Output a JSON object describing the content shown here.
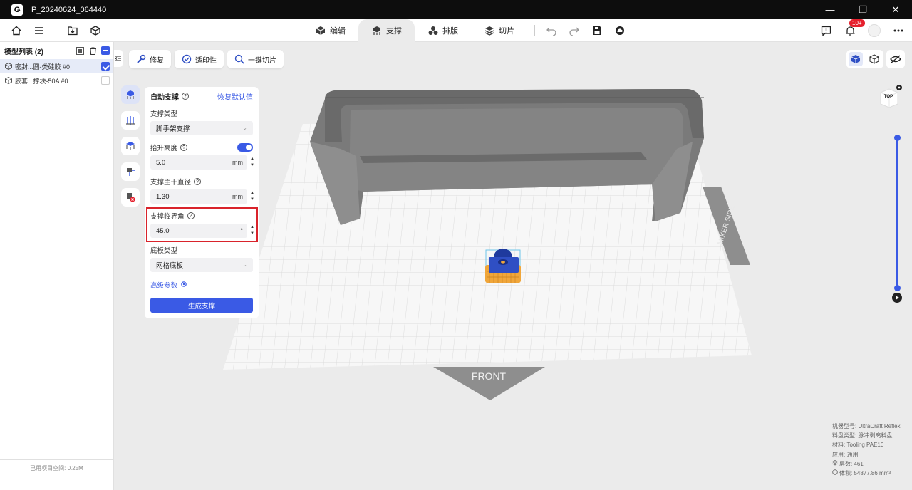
{
  "window": {
    "title": "P_20240624_064440",
    "logo_letter": "Ǥ",
    "controls": {
      "minimize": "—",
      "maximize": "❐",
      "close": "✕"
    }
  },
  "toolbar": {
    "tabs": [
      {
        "label": "编辑",
        "icon": "edit-cube-icon"
      },
      {
        "label": "支撑",
        "icon": "support-icon",
        "active": true
      },
      {
        "label": "排版",
        "icon": "layout-icon"
      },
      {
        "label": "切片",
        "icon": "slice-icon"
      }
    ],
    "notification_badge": "10+"
  },
  "sidebar": {
    "title": "模型列表 (2)",
    "models": [
      {
        "name": "密封...圆-类硅胶 #0",
        "selected": true
      },
      {
        "name": "胶套...撑块-50A #0",
        "selected": false
      }
    ],
    "storage": "已用项目空间: 0.25M"
  },
  "tools": {
    "repair": "修复",
    "printability": "适印性",
    "one_click_slice": "一键切片"
  },
  "support_panel": {
    "title": "自动支撑",
    "reset": "恢复默认值",
    "support_type_label": "支撑类型",
    "support_type_value": "脚手架支撑",
    "lift_height_label": "抬升高度",
    "lift_height_enabled": true,
    "lift_height_value": "5.0",
    "lift_height_unit": "mm",
    "trunk_diameter_label": "支撑主干直径",
    "trunk_diameter_value": "1.30",
    "trunk_diameter_unit": "mm",
    "critical_angle_label": "支撑临界角",
    "critical_angle_value": "45.0",
    "critical_angle_unit": "°",
    "base_type_label": "底板类型",
    "base_type_value": "网格底板",
    "advanced": "高级参数",
    "generate": "生成支撑"
  },
  "scene": {
    "front_label": "FRONT",
    "side_label": "MIXER SIDE",
    "cube_label": "TOP"
  },
  "info": {
    "machine": "机器型号: UltraCraft Reflex",
    "tray": "料盘类型: 脉冲剥离料盘",
    "material": "材料: Tooling PAE10",
    "application": "应用: 通用",
    "layers": "层数: 461",
    "volume": "体积: 54877.86 mm³"
  },
  "colors": {
    "accent": "#3a5ae5",
    "highlight": "#d9232b",
    "model_gray": "#8a8a8a",
    "part_blue": "#2f4fc4",
    "support_orange": "#f0a63a"
  }
}
